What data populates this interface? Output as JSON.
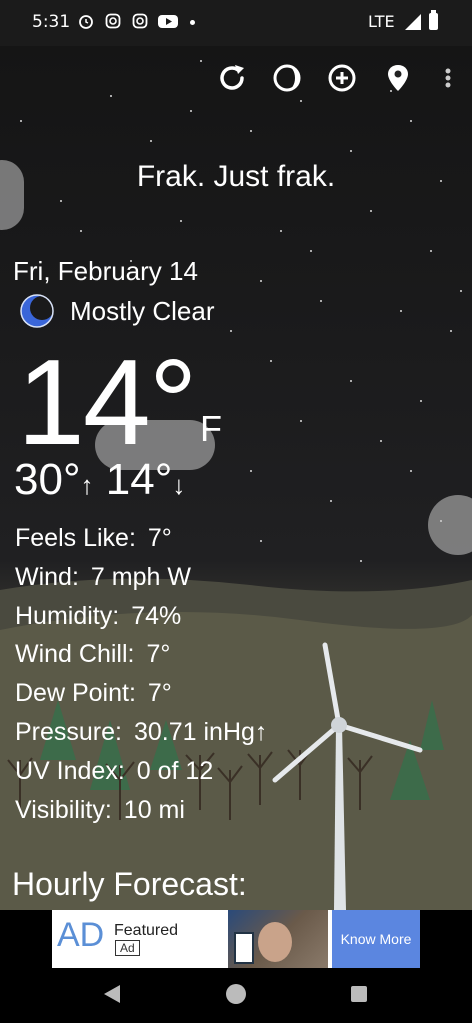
{
  "status_bar": {
    "time": "5:31",
    "network": "LTE",
    "notification_icons": [
      "alarm-icon",
      "instagram-icon",
      "instagram-icon",
      "youtube-icon",
      "more-dot"
    ]
  },
  "toolbar": {
    "icons": [
      "refresh-icon",
      "moon-phase-icon",
      "add-location-icon",
      "location-pin-icon",
      "overflow-menu-icon"
    ]
  },
  "headline": "Frak. Just frak.",
  "current": {
    "date": "Fri, February 14",
    "condition": "Mostly Clear",
    "condition_icon": "moon-icon",
    "temperature": "14°",
    "unit": "F",
    "high": "30°",
    "low": "14°",
    "high_arrow": "↑",
    "low_arrow": "↓"
  },
  "details": [
    {
      "label": "Feels Like:",
      "value": "7°"
    },
    {
      "label": "Wind:",
      "value": "7 mph W"
    },
    {
      "label": "Humidity:",
      "value": "74%"
    },
    {
      "label": "Wind Chill:",
      "value": "7°"
    },
    {
      "label": "Dew Point:",
      "value": "7°"
    },
    {
      "label": "Pressure:",
      "value": "30.71 inHg↑"
    },
    {
      "label": "UV Index:",
      "value": "0 of 12"
    },
    {
      "label": "Visibility:",
      "value": "10 mi"
    }
  ],
  "hourly_heading": "Hourly Forecast:",
  "ad": {
    "mark": "AD",
    "featured": "Featured",
    "badge": "Ad",
    "cta": "Know More"
  },
  "colors": {
    "ad_blue": "#5b86e0",
    "moon_blue": "#3a66d9",
    "background": "#1a1a1b"
  }
}
